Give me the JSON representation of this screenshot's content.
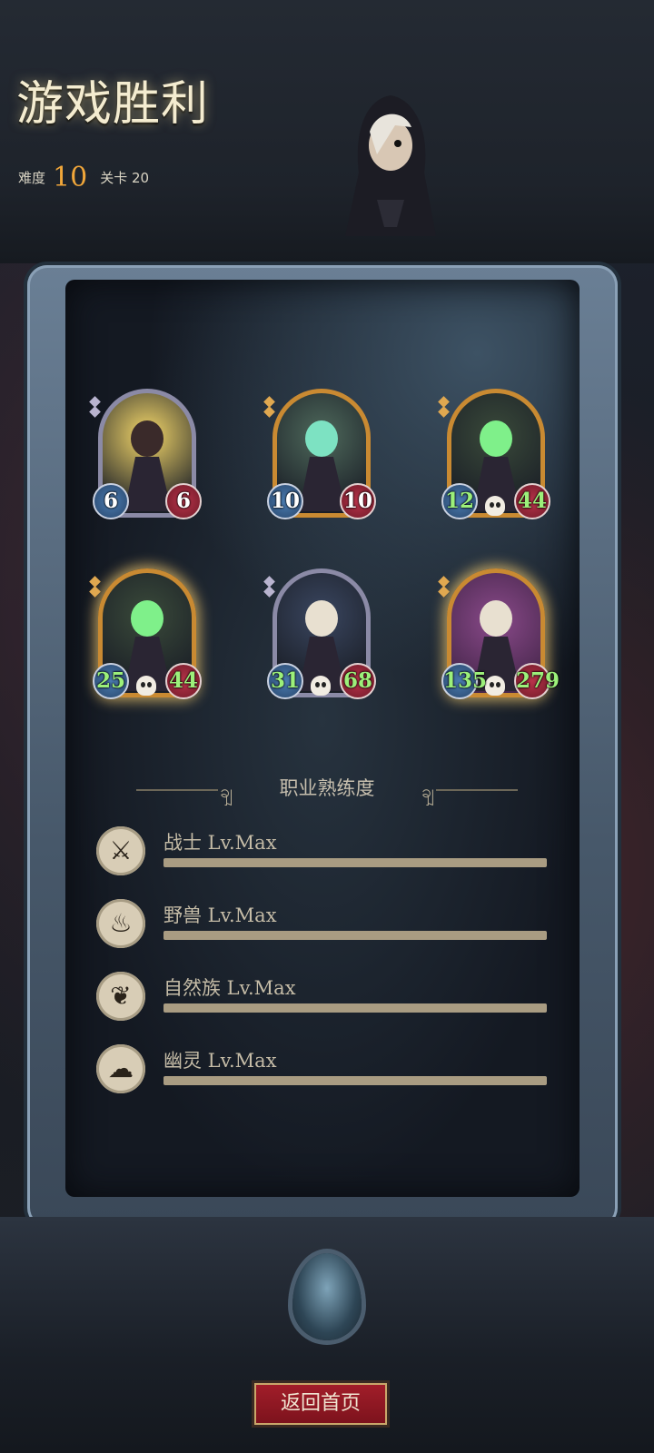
{
  "header": {
    "title": "游戏胜利",
    "difficulty_label": "难度",
    "difficulty_value": "10",
    "stage_label": "关卡 20"
  },
  "cards": [
    {
      "atk": "6",
      "hp": "6",
      "frame": "silver",
      "skull": false,
      "buffed": false,
      "glow": false,
      "art_icon": "warrior-icon"
    },
    {
      "atk": "10",
      "hp": "10",
      "frame": "gold",
      "skull": false,
      "buffed": false,
      "glow": false,
      "art_icon": "ghost-skull-icon"
    },
    {
      "atk": "12",
      "hp": "44",
      "frame": "gold",
      "skull": true,
      "buffed": true,
      "glow": false,
      "art_icon": "reaper-icon"
    },
    {
      "atk": "25",
      "hp": "44",
      "frame": "gold",
      "skull": true,
      "buffed": true,
      "glow": true,
      "art_icon": "reaper-icon"
    },
    {
      "atk": "31",
      "hp": "68",
      "frame": "silver",
      "skull": true,
      "buffed": true,
      "glow": false,
      "art_icon": "witch-icon"
    },
    {
      "atk": "135",
      "hp": "279",
      "frame": "gold",
      "skull": true,
      "buffed": true,
      "glow": true,
      "art_icon": "witch-icon"
    }
  ],
  "proficiency": {
    "title": "职业熟练度",
    "rows": [
      {
        "label": "战士 Lv.Max",
        "progress": 1.0,
        "icon": "sword-icon"
      },
      {
        "label": "野兽 Lv.Max",
        "progress": 1.0,
        "icon": "claw-icon"
      },
      {
        "label": "自然族 Lv.Max",
        "progress": 1.0,
        "icon": "nature-icon"
      },
      {
        "label": "幽灵 Lv.Max",
        "progress": 1.0,
        "icon": "ghost-icon"
      }
    ]
  },
  "home_button": {
    "label": "返回首页"
  },
  "colors": {
    "accent": "#f0a63a",
    "button": "#a31e2a",
    "bar": "#a99c82"
  }
}
